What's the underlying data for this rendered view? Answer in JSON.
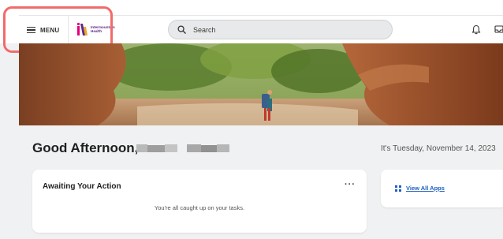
{
  "header": {
    "menu_label": "MENU",
    "logo": {
      "line1": "Intermountain",
      "line2": "Health"
    },
    "search": {
      "placeholder": "Search"
    }
  },
  "icons": {
    "menu": "hamburger-icon",
    "search": "search-icon",
    "notifications": "bell-icon",
    "inbox": "inbox-icon",
    "apps": "grid-icon"
  },
  "main": {
    "greeting": "Good Afternoon,",
    "date_text": "It's Tuesday, November 14, 2023",
    "awaiting": {
      "title": "Awaiting Your Action",
      "more": "···",
      "empty_message": "You're all caught up on your tasks."
    },
    "apps": {
      "link_label": "View All Apps"
    }
  },
  "colors": {
    "accent_link": "#1f5fbf",
    "brand_purple": "#5b2a86",
    "brand_pink": "#e4007c",
    "annotation_red": "#f26b6b"
  }
}
